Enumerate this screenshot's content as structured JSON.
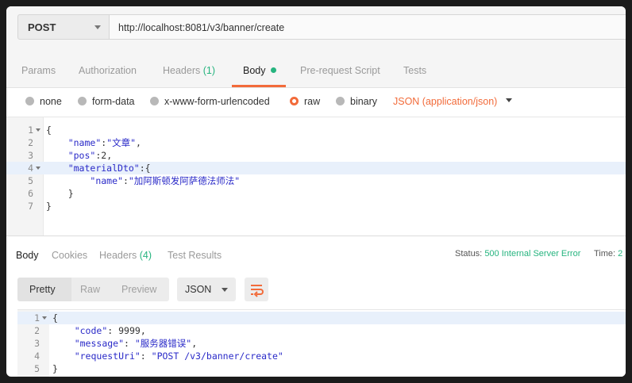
{
  "request": {
    "method": "POST",
    "url": "http://localhost:8081/v3/banner/create"
  },
  "request_tabs": [
    {
      "label": "Params"
    },
    {
      "label": "Authorization"
    },
    {
      "label": "Headers",
      "count": "(1)"
    },
    {
      "label": "Body",
      "active": true
    },
    {
      "label": "Pre-request Script"
    },
    {
      "label": "Tests"
    }
  ],
  "body_types": [
    "none",
    "form-data",
    "x-www-form-urlencoded",
    "raw",
    "binary"
  ],
  "body_type_selected": "raw",
  "content_type": "JSON (application/json)",
  "request_code": [
    {
      "num": "1",
      "text": "{",
      "fold": true
    },
    {
      "num": "2",
      "key": "\"name\"",
      "sep": ":",
      "val": "\"文章\"",
      "tail": ","
    },
    {
      "num": "3",
      "key": "\"pos\"",
      "sep": ":",
      "val": "2",
      "tail": ","
    },
    {
      "num": "4",
      "key": "\"materialDto\"",
      "sep": ":",
      "val": "{",
      "tail": "",
      "fold": true,
      "highlight": true
    },
    {
      "num": "5",
      "key": "\"name\"",
      "sep": ":",
      "val": "\"加阿斯顿发阿萨德法师法\"",
      "tail": ""
    },
    {
      "num": "6",
      "text": "    }"
    },
    {
      "num": "7",
      "text": "}"
    }
  ],
  "response_tabs": [
    {
      "label": "Body",
      "active": true
    },
    {
      "label": "Cookies"
    },
    {
      "label": "Headers",
      "count": "(4)"
    },
    {
      "label": "Test Results"
    }
  ],
  "status": {
    "label": "Status:",
    "value": "500 Internal Server Error"
  },
  "time": {
    "label": "Time:",
    "value": "2"
  },
  "view_modes": [
    "Pretty",
    "Raw",
    "Preview"
  ],
  "view_mode_selected": "Pretty",
  "format": "JSON",
  "wrap_icon": "wrap-lines-icon",
  "response_code": [
    {
      "num": "1",
      "text": "{",
      "fold": true,
      "highlight": true
    },
    {
      "num": "2",
      "key": "\"code\"",
      "sep": ": ",
      "val": "9999",
      "tail": ","
    },
    {
      "num": "3",
      "key": "\"message\"",
      "sep": ": ",
      "val": "\"服务器错误\"",
      "tail": ","
    },
    {
      "num": "4",
      "key": "\"requestUri\"",
      "sep": ": ",
      "val": "\"POST /v3/banner/create\"",
      "tail": ""
    },
    {
      "num": "5",
      "text": "}"
    }
  ],
  "colors": {
    "accent": "#f26b3a",
    "success": "#26b47f",
    "json_key": "#2a2ac8"
  }
}
